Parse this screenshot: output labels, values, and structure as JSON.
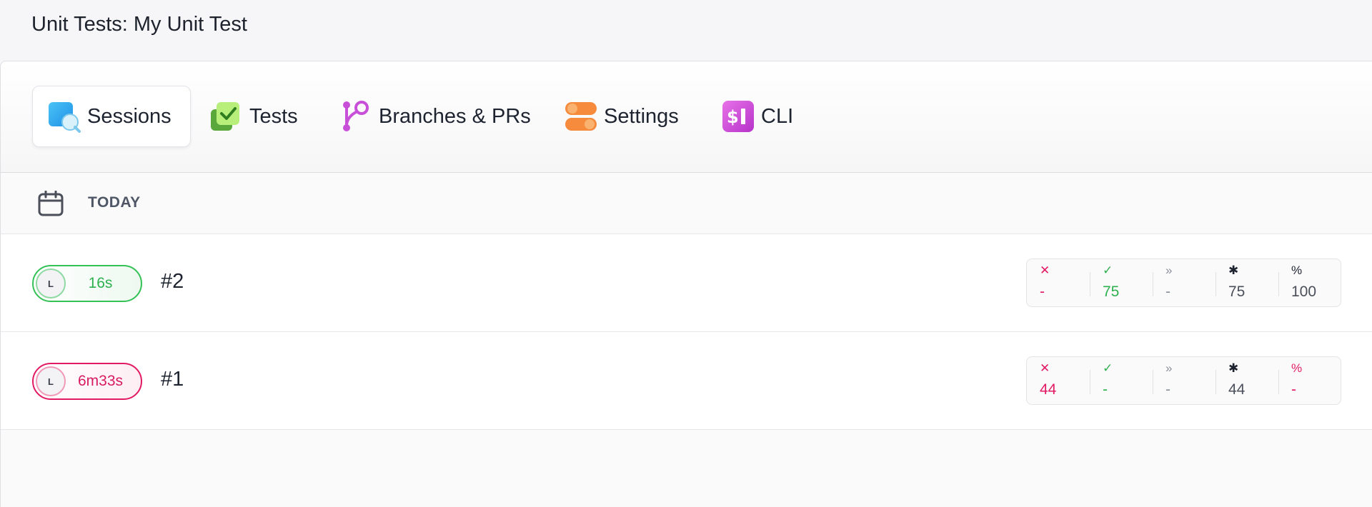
{
  "header": {
    "title": "Unit Tests: My Unit Test"
  },
  "tabs": [
    {
      "label": "Sessions",
      "icon": "sessions-icon",
      "active": true
    },
    {
      "label": "Tests",
      "icon": "tests-icon",
      "active": false
    },
    {
      "label": "Branches & PRs",
      "icon": "branches-icon",
      "active": false
    },
    {
      "label": "Settings",
      "icon": "settings-icon",
      "active": false
    },
    {
      "label": "CLI",
      "icon": "cli-icon",
      "active": false
    }
  ],
  "date_group": {
    "label": "TODAY",
    "icon": "calendar-icon"
  },
  "sessions": [
    {
      "number": "#2",
      "avatar": "L",
      "duration": "16s",
      "status": "pass",
      "stats": {
        "failed": "-",
        "passed": "75",
        "skipped": "-",
        "total": "75",
        "percent": "100"
      }
    },
    {
      "number": "#1",
      "avatar": "L",
      "duration": "6m33s",
      "status": "fail",
      "stats": {
        "failed": "44",
        "passed": "-",
        "skipped": "-",
        "total": "44",
        "percent": "-"
      }
    }
  ],
  "stat_symbols": {
    "failed": "✕",
    "passed": "✓",
    "skipped": "»",
    "total": "✱",
    "percent": "%"
  },
  "colors": {
    "fail": "#e21a63",
    "pass": "#2fb14f",
    "muted": "#8a8f98"
  }
}
